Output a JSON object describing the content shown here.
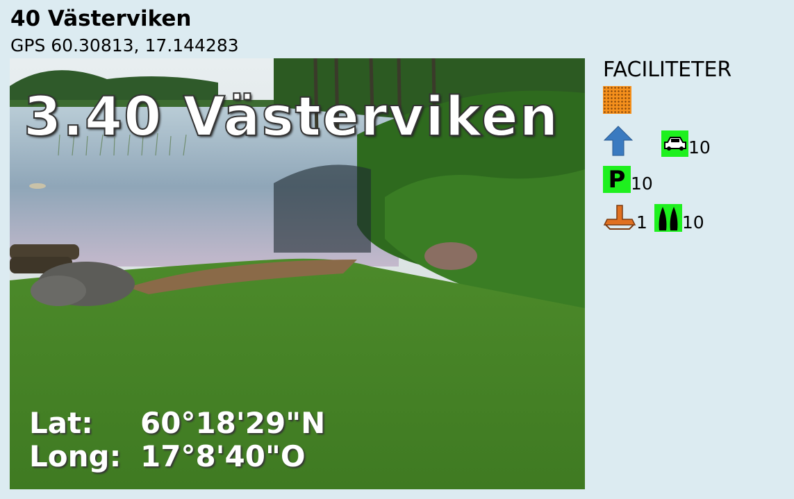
{
  "page": {
    "title": "40 Västerviken",
    "gps": "GPS 60.30813, 17.144283"
  },
  "photo": {
    "caption": "3.40 Västerviken",
    "lat_label": "Lat:",
    "lat_value": "60°18'29\"N",
    "long_label": "Long:",
    "long_value": "17°8'40\"O"
  },
  "facilities": {
    "heading": "FACILITETER",
    "icons": [
      "sand-beach-icon",
      "arrow-up-icon",
      "car-icon",
      "parking-icon",
      "anchor-icon",
      "boats-icon"
    ],
    "car_count": "10",
    "parking_count": "10",
    "anchor_count": "1",
    "boats_count": "10"
  },
  "colors": {
    "background": "#dcebf1",
    "facility_green": "#1ef01e",
    "sand_orange": "#f5901c",
    "arrow_blue": "#3a7ac0",
    "anchor_orange": "#e07020"
  }
}
